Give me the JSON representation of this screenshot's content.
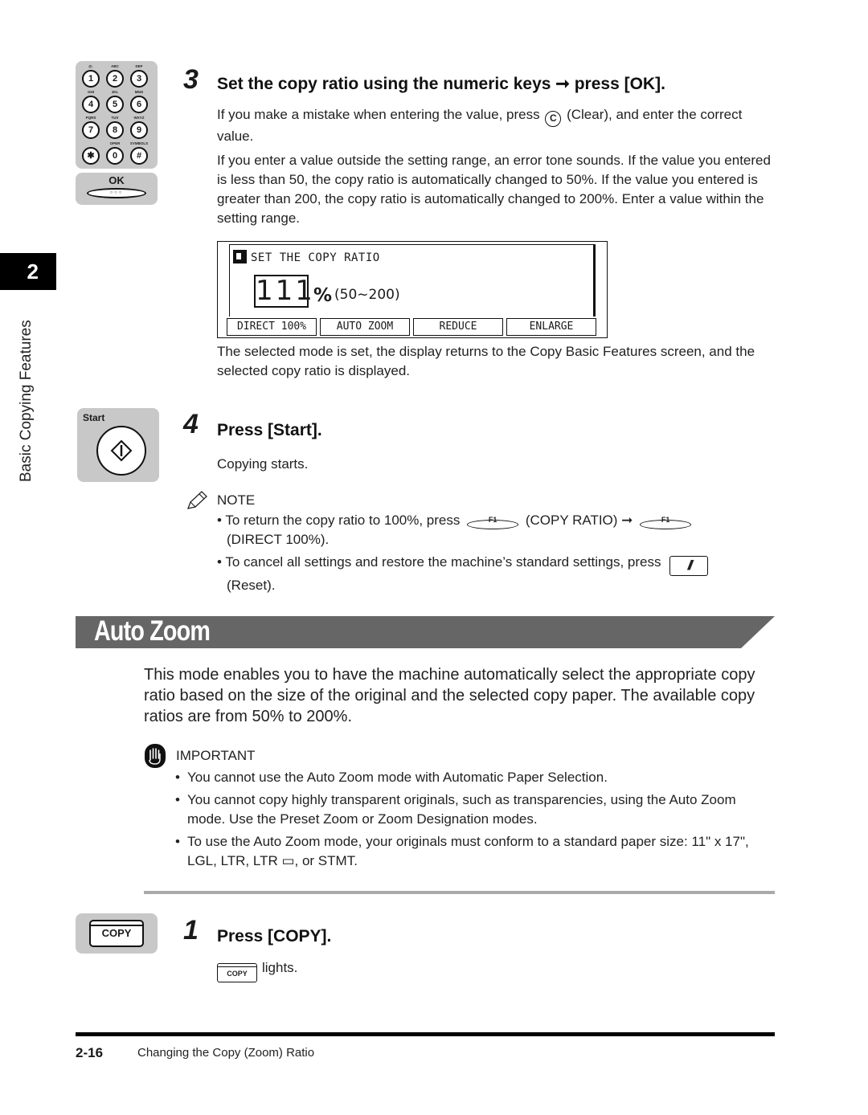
{
  "chapter": {
    "number": "2",
    "title": "Basic Copying Features"
  },
  "keypad": {
    "keys": [
      {
        "label": "1",
        "sub": "@."
      },
      {
        "label": "2",
        "sub": "ABC"
      },
      {
        "label": "3",
        "sub": "DEF"
      },
      {
        "label": "4",
        "sub": "GHI"
      },
      {
        "label": "5",
        "sub": "JKL"
      },
      {
        "label": "6",
        "sub": "MNO"
      },
      {
        "label": "7",
        "sub": "PQRS"
      },
      {
        "label": "8",
        "sub": "TUV"
      },
      {
        "label": "9",
        "sub": "WXYZ"
      },
      {
        "label": "✱",
        "sub": ""
      },
      {
        "label": "0",
        "sub": "OPER"
      },
      {
        "label": "#",
        "sub": "SYMBOLS"
      }
    ],
    "ok_label": "OK",
    "ok_dots": "○○○"
  },
  "step3": {
    "number": "3",
    "title": "Set the copy ratio using the numeric keys ➞ press [OK].",
    "para1_before": "If you make a mistake when entering the value, press",
    "clear_key": "C",
    "para1_after": "(Clear), and enter the correct value.",
    "para2": "If you enter a value outside the setting range, an error tone sounds. If the value you entered is less than 50, the copy ratio is automatically changed to 50%. If the value you entered is greater than 200, the copy ratio is automatically changed to 200%. Enter a value within the setting range.",
    "after_lcd": "The selected mode is set, the display returns to the Copy Basic Features screen, and the selected copy ratio is displayed."
  },
  "lcd": {
    "title": "SET THE COPY RATIO",
    "value": "111",
    "percent": "%",
    "range": "(50~200)",
    "buttons": [
      "DIRECT 100%",
      "AUTO ZOOM",
      "REDUCE",
      "ENLARGE"
    ]
  },
  "step4": {
    "number": "4",
    "title": "Press [Start].",
    "body": "Copying starts.",
    "key_label": "Start"
  },
  "note": {
    "heading": "NOTE",
    "item1_a": "To return the copy ratio to 100%, press",
    "f1": "F1",
    "item1_b": "(COPY RATIO) ➞",
    "item1_c": "(DIRECT 100%).",
    "item2_a": "To cancel all settings and restore the machine’s standard settings, press",
    "reset_glyph": "//",
    "item2_b": "(Reset)."
  },
  "section": {
    "title": "Auto Zoom",
    "bar_color": "#666666",
    "intro": "This mode enables you to have the machine automatically select the appropriate copy ratio based on the size of the original and the selected copy paper. The available copy ratios are from 50% to 200%."
  },
  "important": {
    "heading": "IMPORTANT",
    "items": [
      "You cannot use the Auto Zoom mode with Automatic Paper Selection.",
      "You cannot copy highly transparent originals, such as transparencies, using the Auto Zoom mode. Use the Preset Zoom or Zoom Designation modes.",
      "To use the Auto Zoom mode, your originals must conform to a standard paper size: 11\" x 17\", LGL, LTR, LTR ▭, or STMT."
    ]
  },
  "step1": {
    "number": "1",
    "title": "Press [COPY].",
    "key_label": "COPY",
    "body": "lights."
  },
  "footer": {
    "page": "2-16",
    "title": "Changing the Copy (Zoom) Ratio"
  }
}
